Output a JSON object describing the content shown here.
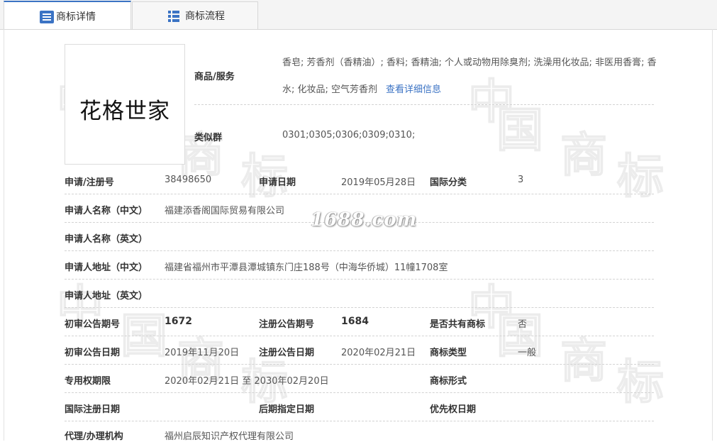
{
  "tabs": [
    {
      "label": "商标详情",
      "active": true,
      "icon": "list-icon"
    },
    {
      "label": "商标流程",
      "active": false,
      "icon": "grid-icon"
    }
  ],
  "trademark": {
    "image_text": "花格世家"
  },
  "watermark": {
    "site": "1688.com"
  },
  "goods_services": {
    "label": "商品/服务",
    "value": "香皂; 芳香剂（香精油）; 香料; 香精油; 个人或动物用除臭剂; 洗澡用化妆品; 非医用香膏; 香水; 化妆品; 空气芳香剂",
    "link": "查看详细信息"
  },
  "similar_group": {
    "label": "类似群",
    "value": "0301;0305;0306;0309;0310;"
  },
  "fields": {
    "reg_no": {
      "label": "申请/注册号",
      "value": "38498650"
    },
    "apply_date": {
      "label": "申请日期",
      "value": "2019年05月28日"
    },
    "intl_class": {
      "label": "国际分类",
      "value": "3"
    },
    "applicant_cn": {
      "label": "申请人名称（中文）",
      "value": "福建添香阁国际贸易有限公司"
    },
    "applicant_en": {
      "label": "申请人名称（英文）",
      "value": ""
    },
    "address_cn": {
      "label": "申请人地址（中文）",
      "value": "福建省福州市平潭县潭城镇东门庄188号（中海华侨城）11幢1708室"
    },
    "address_en": {
      "label": "申请人地址（英文）",
      "value": ""
    },
    "prelim_issue": {
      "label": "初审公告期号",
      "value": "1672"
    },
    "reg_issue": {
      "label": "注册公告期号",
      "value": "1684"
    },
    "shared": {
      "label": "是否共有商标",
      "value": "否"
    },
    "prelim_date": {
      "label": "初审公告日期",
      "value": "2019年11月20日"
    },
    "reg_date": {
      "label": "注册公告日期",
      "value": "2020年02月21日"
    },
    "tm_type": {
      "label": "商标类型",
      "value": "一般"
    },
    "exclusive_period": {
      "label": "专用权期限",
      "value": "2020年02月21日 至 2030年02月20日"
    },
    "tm_form": {
      "label": "商标形式",
      "value": ""
    },
    "intl_reg_date": {
      "label": "国际注册日期",
      "value": ""
    },
    "later_date": {
      "label": "后期指定日期",
      "value": ""
    },
    "priority_date": {
      "label": "优先权日期",
      "value": ""
    },
    "agent": {
      "label": "代理/办理机构",
      "value": "福州启辰知识产权代理有限公司"
    }
  }
}
